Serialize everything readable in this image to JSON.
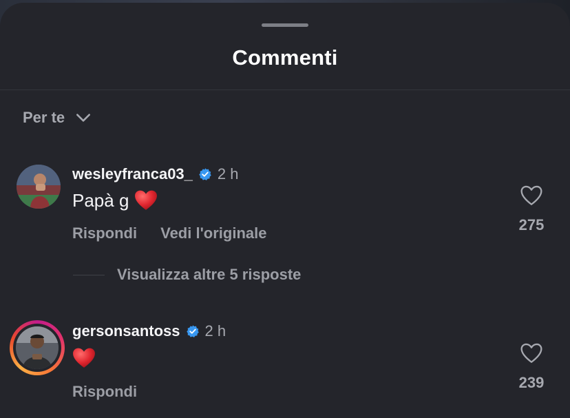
{
  "header": {
    "title": "Commenti"
  },
  "sort": {
    "label": "Per te"
  },
  "comments": [
    {
      "username": "wesleyfranca03_",
      "verified": true,
      "time": "2 h",
      "text": "Papà g",
      "emoji": "heart-emoji",
      "actions": [
        "Rispondi",
        "Vedi l'originale"
      ],
      "likes": "275"
    },
    {
      "username": "gersonsantoss",
      "verified": true,
      "time": "2 h",
      "text": "",
      "emoji": "heart-emoji",
      "actions": [
        "Rispondi"
      ],
      "likes": "239",
      "has_story_ring": true
    }
  ],
  "replies": {
    "label": "Visualizza altre 5 risposte"
  },
  "colors": {
    "background": "#24252b",
    "text": "#f4f4f6",
    "muted": "#a7a9b0",
    "verified": "#3897f0",
    "heart": "#e0262f"
  }
}
